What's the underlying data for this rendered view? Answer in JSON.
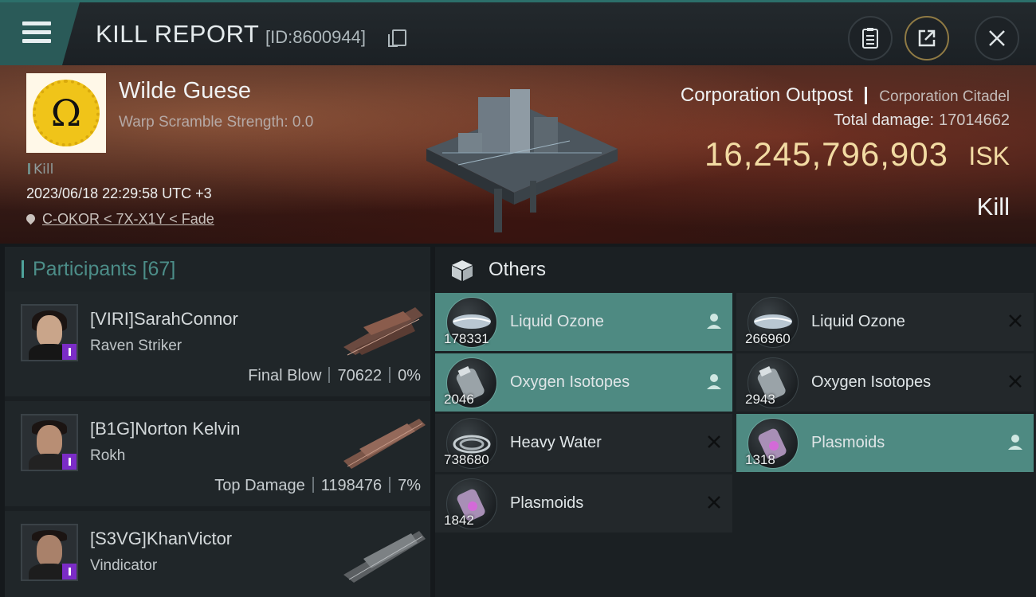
{
  "header": {
    "title": "KILL REPORT",
    "report_id": "[ID:8600944]",
    "icons": [
      "menu-icon",
      "copy-icon",
      "clipboard-icon",
      "share-icon",
      "close-icon"
    ]
  },
  "victim": {
    "name": "Wilde Guese",
    "scramble": "Warp Scramble Strength: 0.0",
    "kill_tag": "Kill",
    "datetime": "2023/06/18 22:29:58 UTC +3",
    "location": "C-OKOR < 7X-X1Y < Fade"
  },
  "target": {
    "type": "Corporation Outpost",
    "group": "Corporation Citadel",
    "total_damage_label": "Total damage:",
    "total_damage": "17014662",
    "isk_value": "16,245,796,903",
    "isk_unit": "ISK",
    "result": "Kill"
  },
  "participants": {
    "title": "Participants [67]",
    "rows": [
      {
        "pilot": "[VIRI]SarahConnor",
        "ship": "Raven Striker",
        "role": "Final Blow",
        "damage": "70622",
        "percent": "0%"
      },
      {
        "pilot": "[B1G]Norton Kelvin",
        "ship": "Rokh",
        "role": "Top Damage",
        "damage": "1198476",
        "percent": "7%"
      },
      {
        "pilot": "[S3VG]KhanVictor",
        "ship": "Vindicator",
        "role": "",
        "damage": "",
        "percent": ""
      }
    ]
  },
  "others": {
    "title": "Others",
    "items": [
      {
        "name": "Liquid Ozone",
        "qty": "178331",
        "status": "person-icon",
        "highlight": true
      },
      {
        "name": "Liquid Ozone",
        "qty": "266960",
        "status": "x-icon",
        "highlight": false
      },
      {
        "name": "Oxygen Isotopes",
        "qty": "2046",
        "status": "person-icon",
        "highlight": true
      },
      {
        "name": "Oxygen Isotopes",
        "qty": "2943",
        "status": "x-icon",
        "highlight": false
      },
      {
        "name": "Heavy Water",
        "qty": "738680",
        "status": "x-icon",
        "highlight": false
      },
      {
        "name": "Plasmoids",
        "qty": "1318",
        "status": "person-icon",
        "highlight": true
      },
      {
        "name": "Plasmoids",
        "qty": "1842",
        "status": "x-icon",
        "highlight": false
      }
    ]
  },
  "colors": {
    "accent_teal": "#4e8a82",
    "isk_gold": "#f2dba3",
    "badge_purple": "#7b2cc7"
  }
}
